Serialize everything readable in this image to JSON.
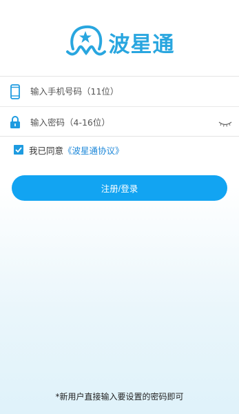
{
  "app": {
    "name": "波星通",
    "brand_color": "#29a6df",
    "accent_color": "#12a4f2"
  },
  "form": {
    "phone_placeholder": "输入手机号码（11位）",
    "phone_icon": "phone-icon",
    "password_placeholder": "输入密码（4-16位）",
    "password_icon": "lock-icon",
    "visibility_icon": "eye-closed-icon"
  },
  "agreement": {
    "checked": true,
    "text": "我已同意",
    "link": "《波星通协议》"
  },
  "submit_label": "注册/登录",
  "hint": "*新用户直接输入要设置的密码即可"
}
